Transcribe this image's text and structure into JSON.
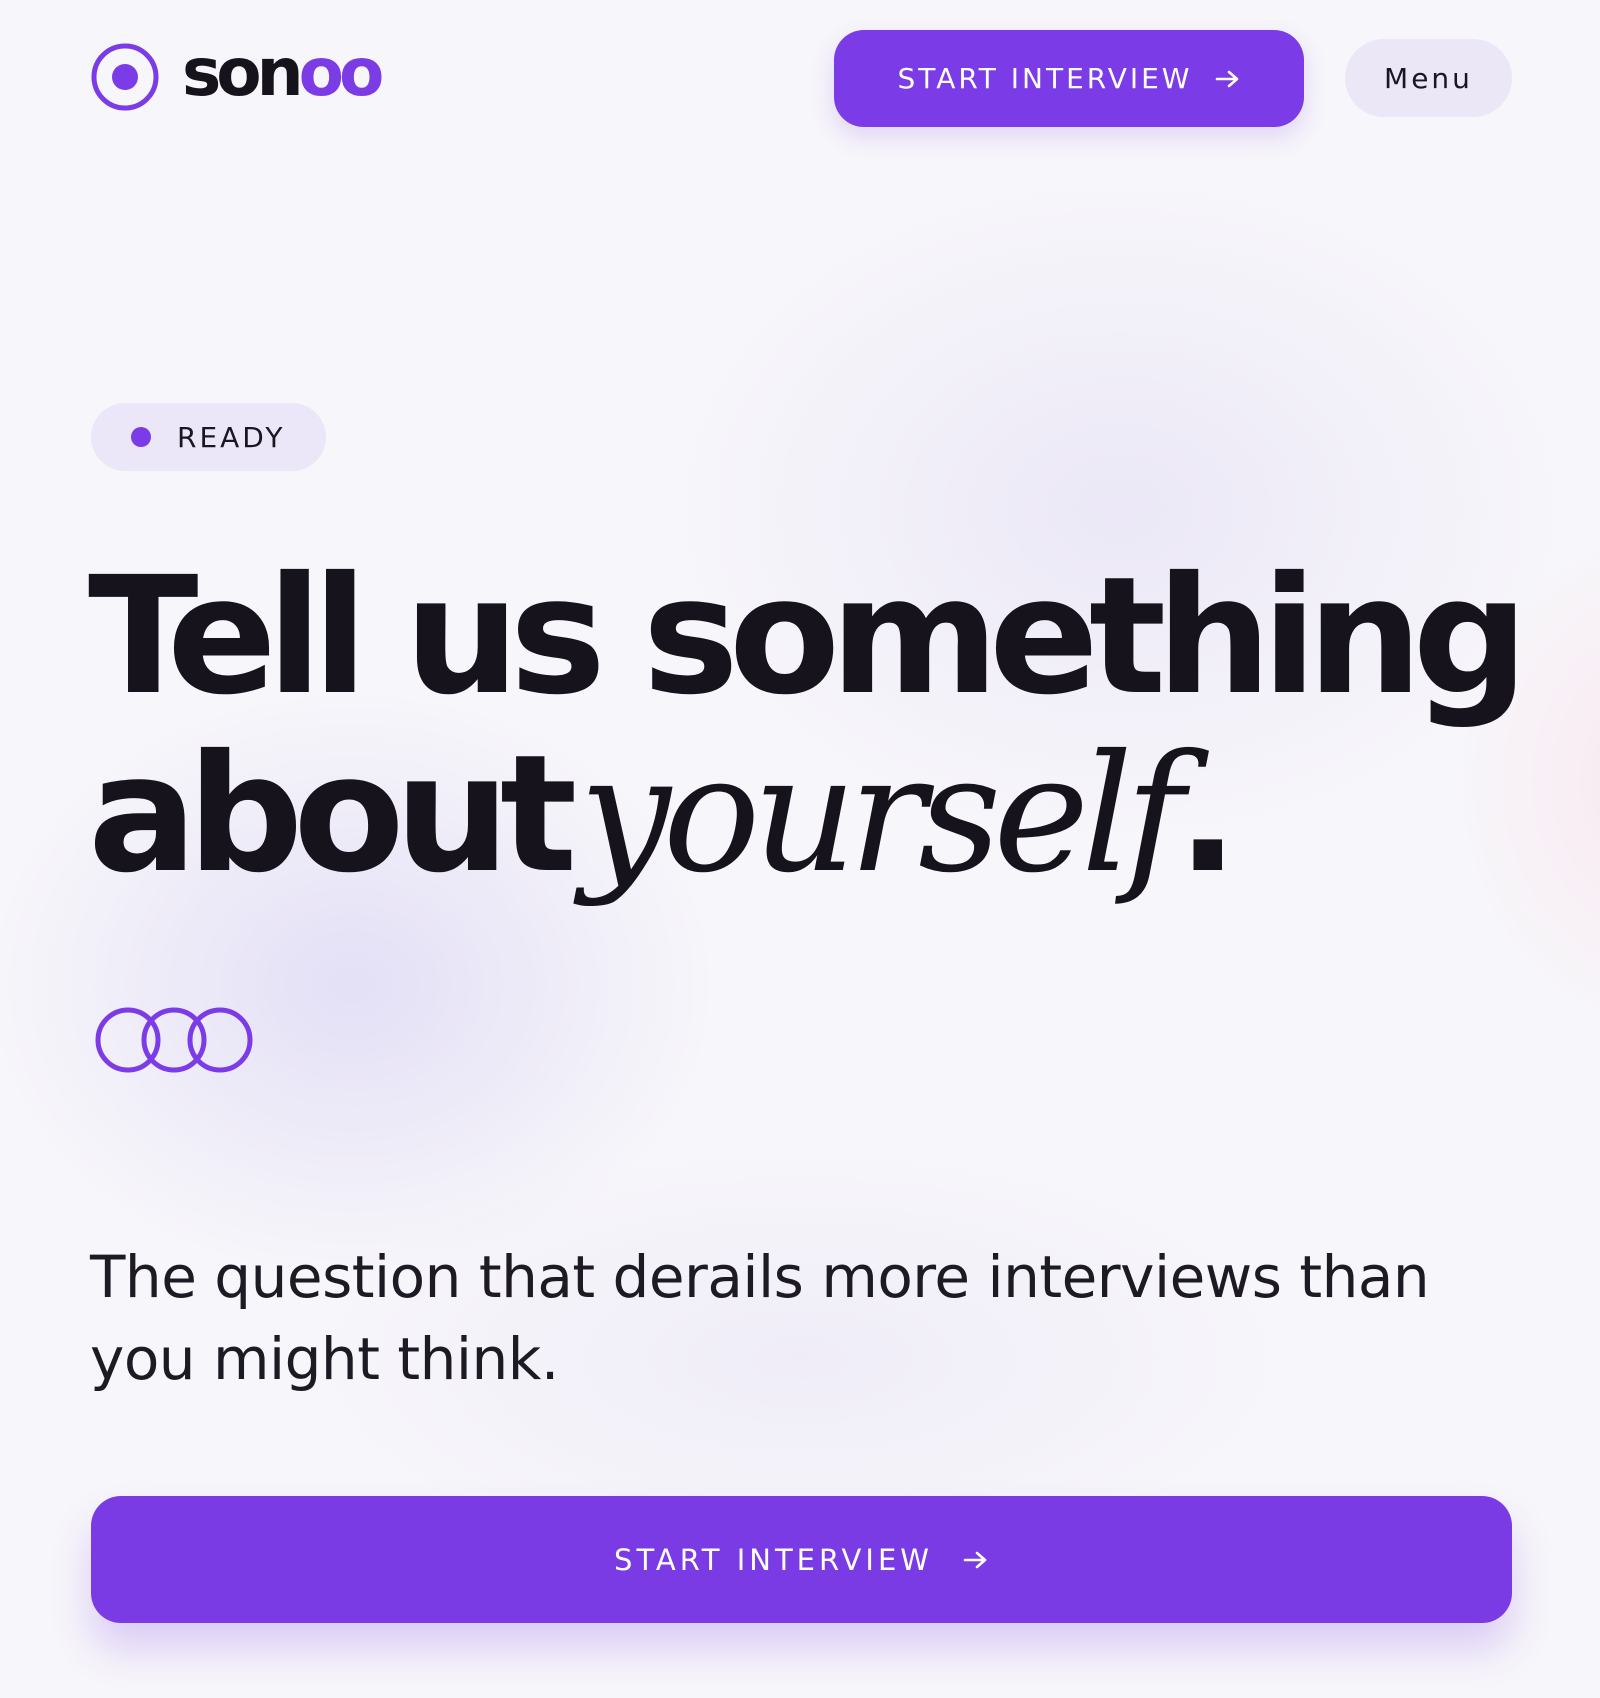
{
  "brand": {
    "name_part_1": "son",
    "name_part_2": "oo",
    "accent_color": "#7b3be6",
    "dark_color": "#16131d"
  },
  "header": {
    "cta_label": "START INTERVIEW",
    "menu_label": "Menu"
  },
  "status": {
    "label": "READY"
  },
  "hero": {
    "headline_line1": "Tell us something",
    "headline_line2_plain": "about",
    "headline_line2_italic": "yourself",
    "headline_punct": ".",
    "subtitle": "The question that derails more interviews than you might think."
  },
  "main_cta": {
    "label": "START INTERVIEW"
  },
  "icons": {
    "logo": "record-circle-icon",
    "arrow": "arrow-right-icon",
    "rings": "three-rings-icon",
    "status_dot": "dot-icon"
  }
}
